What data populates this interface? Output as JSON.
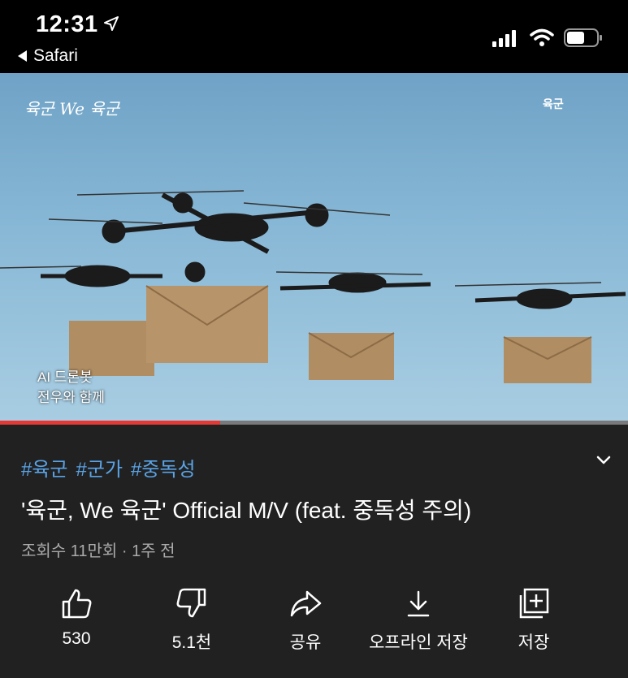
{
  "status_bar": {
    "time": "12:31",
    "back_app": "Safari"
  },
  "video": {
    "logo_left": "육군 We 육군",
    "logo_right": "육군",
    "caption_lines": [
      "AI 드론봇",
      "전우와 함께"
    ],
    "progress_fraction": 0.35,
    "progress_color": "#e53935"
  },
  "info": {
    "hashtags": [
      "#육군",
      "#군가",
      "#중독성"
    ],
    "title": "'육군, We 육군' Official M/V (feat. 중독성 주의)",
    "meta": "조회수 11만회 · 1주 전",
    "hashtag_color": "#5aa3e6"
  },
  "actions": [
    {
      "icon": "thumbs-up-icon",
      "label": "530"
    },
    {
      "icon": "thumbs-down-icon",
      "label": "5.1천"
    },
    {
      "icon": "share-icon",
      "label": "공유"
    },
    {
      "icon": "download-icon",
      "label": "오프라인 저장"
    },
    {
      "icon": "add-to-playlist-icon",
      "label": "저장"
    }
  ]
}
